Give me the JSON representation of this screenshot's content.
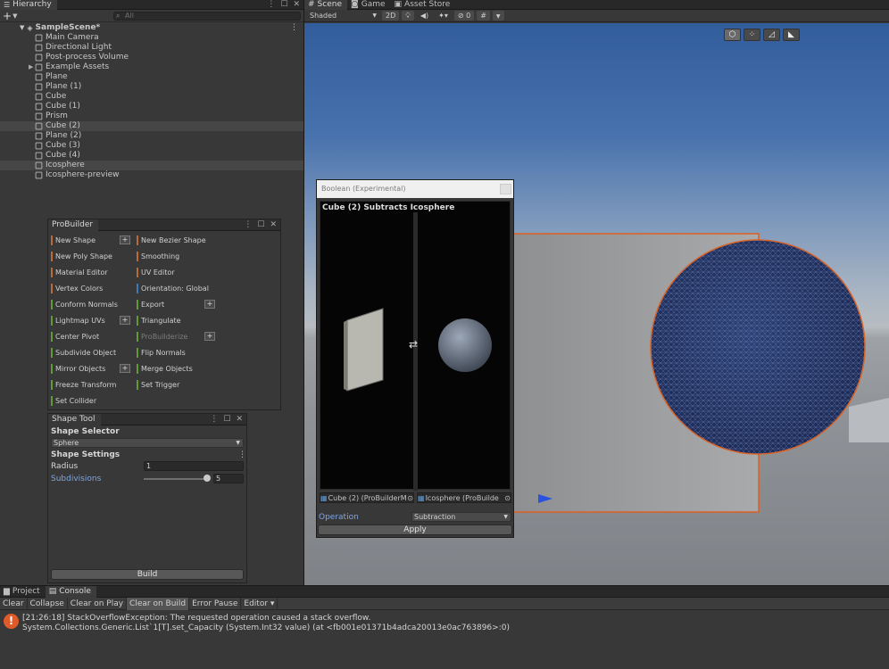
{
  "hierarchy": {
    "tab_label": "Hierarchy",
    "search_placeholder": "All",
    "scene_name": "SampleScene*",
    "items": [
      {
        "label": "Main Camera",
        "selected": false
      },
      {
        "label": "Directional Light",
        "selected": false
      },
      {
        "label": "Post-process Volume",
        "selected": false
      },
      {
        "label": "Example Assets",
        "selected": false
      },
      {
        "label": "Plane",
        "selected": false
      },
      {
        "label": "Plane (1)",
        "selected": false
      },
      {
        "label": "Cube",
        "selected": false
      },
      {
        "label": "Cube (1)",
        "selected": false
      },
      {
        "label": "Prism",
        "selected": false
      },
      {
        "label": "Cube (2)",
        "selected": true
      },
      {
        "label": "Plane (2)",
        "selected": false
      },
      {
        "label": "Cube (3)",
        "selected": false
      },
      {
        "label": "Cube (4)",
        "selected": false
      },
      {
        "label": "Icosphere",
        "selected": true
      },
      {
        "label": "Icosphere-preview",
        "selected": false
      }
    ]
  },
  "scene": {
    "tabs": [
      "Scene",
      "Game",
      "Asset Store"
    ],
    "shading_mode": "Shaded",
    "mode_2d": "2D",
    "hidden_count": "0"
  },
  "probuilder": {
    "title": "ProBuilder",
    "left": [
      {
        "label": "New Shape",
        "color": "#b96a3a",
        "plus": true
      },
      {
        "label": "New Poly Shape",
        "color": "#b96a3a",
        "plus": false
      },
      {
        "label": "Material Editor",
        "color": "#b96a3a",
        "plus": false
      },
      {
        "label": "Vertex Colors",
        "color": "#b96a3a",
        "plus": false
      },
      {
        "label": "Conform Normals",
        "color": "#5e9a3a",
        "plus": false
      },
      {
        "label": "Lightmap UVs",
        "color": "#5e9a3a",
        "plus": true
      },
      {
        "label": "Center Pivot",
        "color": "#5e9a3a",
        "plus": false
      },
      {
        "label": "Subdivide Object",
        "color": "#5e9a3a",
        "plus": false
      },
      {
        "label": "Mirror Objects",
        "color": "#5e9a3a",
        "plus": true
      },
      {
        "label": "Freeze Transform",
        "color": "#5e9a3a",
        "plus": false
      },
      {
        "label": "Set Collider",
        "color": "#5e9a3a",
        "plus": false
      }
    ],
    "right": [
      {
        "label": "New Bezier Shape",
        "color": "#b96a3a",
        "plus": false
      },
      {
        "label": "Smoothing",
        "color": "#b96a3a",
        "plus": false
      },
      {
        "label": "UV Editor",
        "color": "#b96a3a",
        "plus": false
      },
      {
        "label": "Orientation: Global",
        "color": "#3c7ab5",
        "plus": false
      },
      {
        "label": "Export",
        "color": "#5e9a3a",
        "plus": true
      },
      {
        "label": "Triangulate",
        "color": "#5e9a3a",
        "plus": false
      },
      {
        "label": "ProBuilderize",
        "color": "#5e9a3a",
        "plus": true,
        "disabled": true
      },
      {
        "label": "Flip Normals",
        "color": "#5e9a3a",
        "plus": false
      },
      {
        "label": "Merge Objects",
        "color": "#5e9a3a",
        "plus": false
      },
      {
        "label": "Set Trigger",
        "color": "#5e9a3a",
        "plus": false
      }
    ]
  },
  "shape_tool": {
    "title": "Shape Tool",
    "selector_header": "Shape Selector",
    "shape": "Sphere",
    "settings_header": "Shape Settings",
    "radius_label": "Radius",
    "radius_value": "1",
    "subdivisions_label": "Subdivisions",
    "subdivisions_value": "5",
    "build_label": "Build"
  },
  "boolean": {
    "title": "Boolean (Experimental)",
    "preview_caption": "Cube (2) Subtracts Icosphere",
    "left_object": "Cube (2) (ProBuilderM",
    "right_object": "Icosphere (ProBuilde",
    "operation_label": "Operation",
    "operation_value": "Subtraction",
    "apply_label": "Apply"
  },
  "console": {
    "tabs": [
      "Project",
      "Console"
    ],
    "buttons": [
      {
        "label": "Clear",
        "active": false
      },
      {
        "label": "Collapse",
        "active": false
      },
      {
        "label": "Clear on Play",
        "active": false
      },
      {
        "label": "Clear on Build",
        "active": true
      },
      {
        "label": "Error Pause",
        "active": false
      },
      {
        "label": "Editor ▾",
        "active": false
      }
    ],
    "message_line1": "[21:26:18] StackOverflowException: The requested operation caused a stack overflow.",
    "message_line2": "System.Collections.Generic.List`1[T].set_Capacity (System.Int32 value) (at <fb001e01371b4adca20013e0ac763896>:0)"
  }
}
